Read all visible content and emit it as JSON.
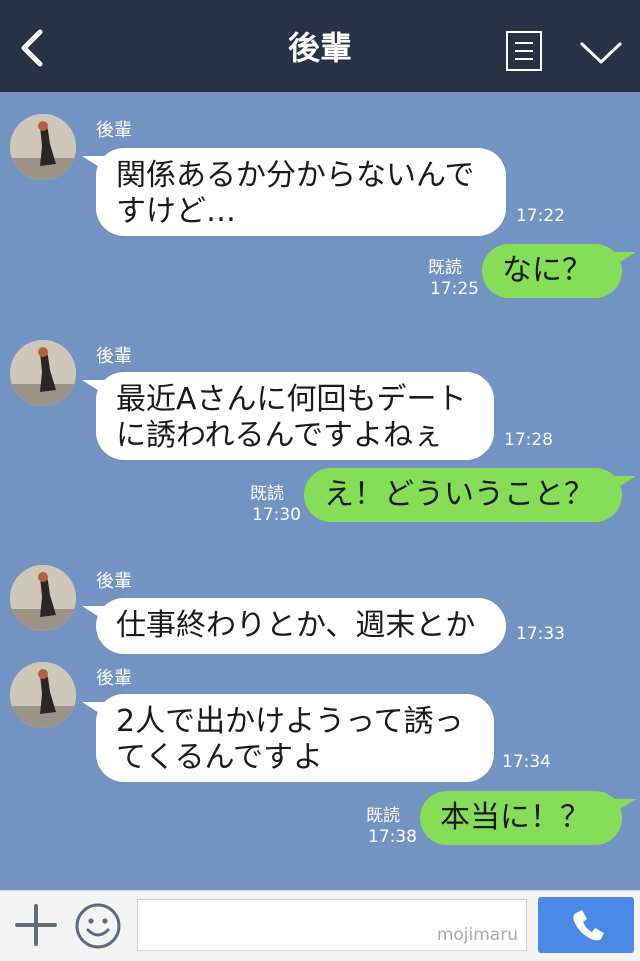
{
  "header": {
    "title": "後輩",
    "back_icon": "chevron-left-icon",
    "menu_icon": "list-icon",
    "dropdown_icon": "chevron-down-icon"
  },
  "messages": [
    {
      "side": "left",
      "sender": "後輩",
      "lines": [
        "関係あるか分からないんで",
        "すけど…"
      ],
      "time": "17:22"
    },
    {
      "side": "right",
      "read": "既読",
      "text": "なに？",
      "time": "17:25"
    },
    {
      "side": "left",
      "sender": "後輩",
      "lines": [
        "最近Aさんに何回もデート",
        "に誘われるんですよねぇ"
      ],
      "time": "17:28"
    },
    {
      "side": "right",
      "read": "既読",
      "text": "え！どういうこと？",
      "time": "17:30"
    },
    {
      "side": "left",
      "sender": "後輩",
      "lines": [
        "仕事終わりとか、週末とか"
      ],
      "time": "17:33"
    },
    {
      "side": "left",
      "sender": "後輩",
      "lines": [
        "2人で出かけようって誘っ",
        "てくるんですよ"
      ],
      "time": "17:34"
    },
    {
      "side": "right",
      "read": "既読",
      "text": "本当に！？",
      "time": "17:38"
    }
  ],
  "footer": {
    "input_value": "",
    "watermark": "mojimaru",
    "plus_icon": "plus-icon",
    "emoji_icon": "smile-icon",
    "call_icon": "phone-icon"
  },
  "colors": {
    "header_bg": "#273246",
    "chat_bg": "#7393c2",
    "outgoing_bubble": "#86de58",
    "incoming_bubble": "#ffffff",
    "call_button": "#4a8ae6"
  }
}
